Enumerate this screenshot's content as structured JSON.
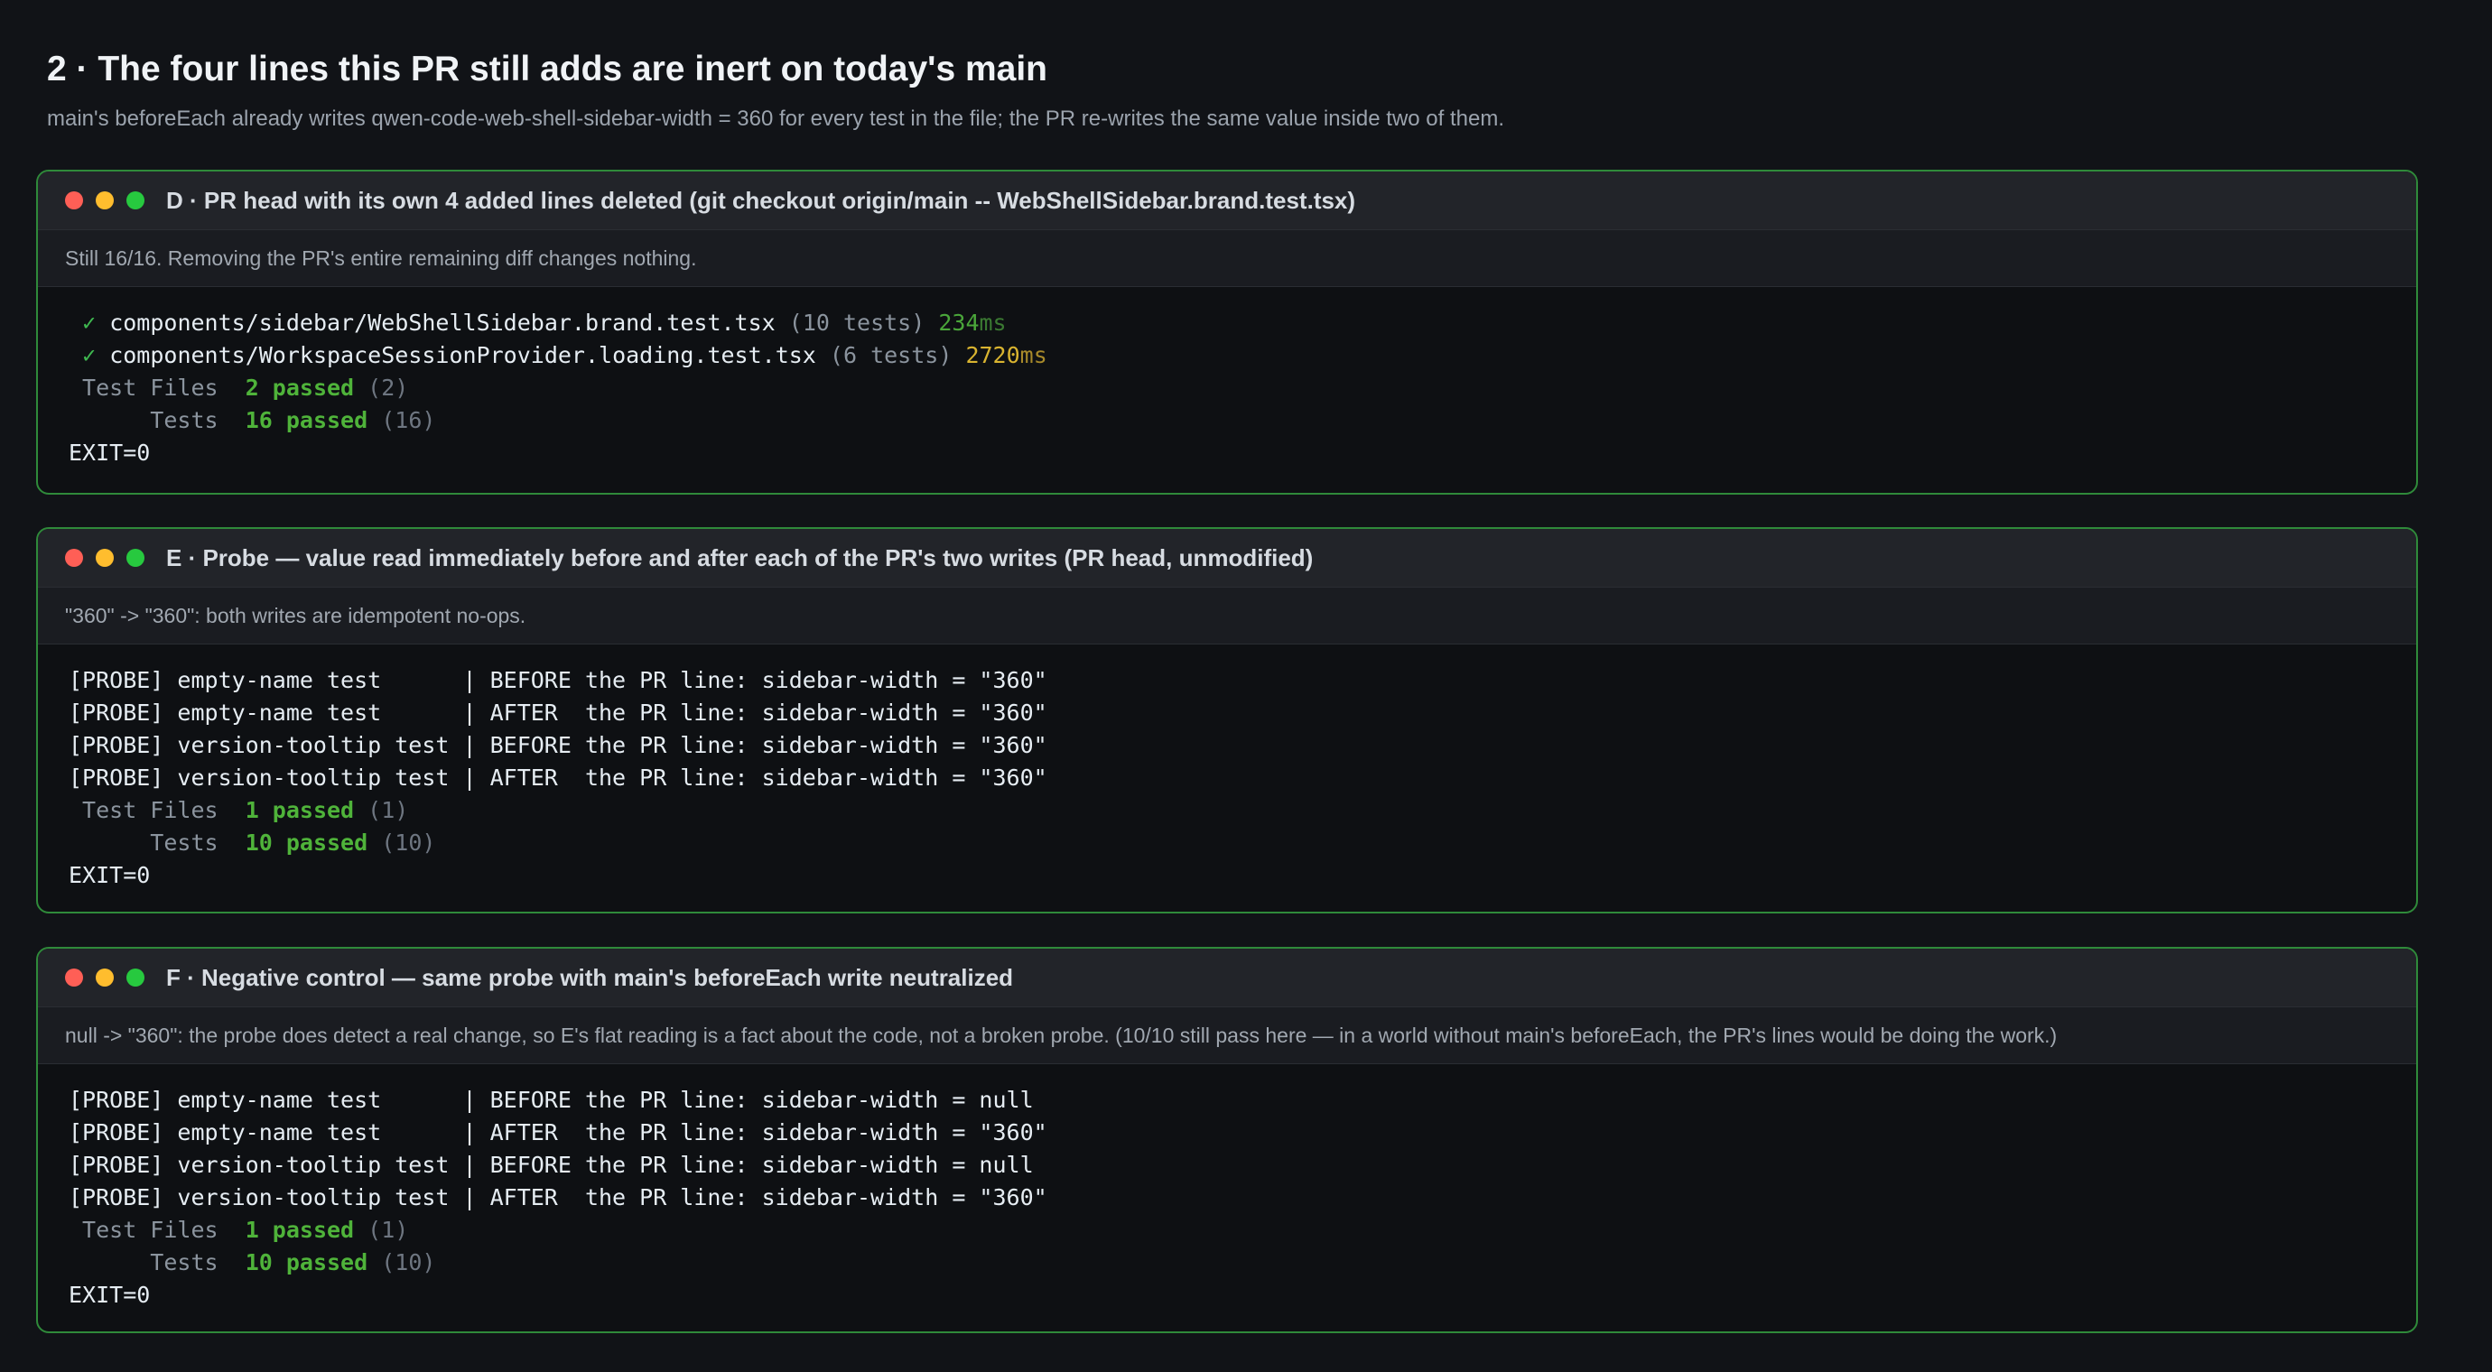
{
  "section": {
    "title": "2 · The four lines this PR still adds are inert on today's main",
    "subtitle": "main's beforeEach already writes qwen-code-web-shell-sidebar-width = 360 for every test in the file; the PR re-writes the same value inside two of them."
  },
  "colors": {
    "background": "#111317",
    "border_green": "#2f8a3a",
    "passed_green": "#4fb33a",
    "ms_yellow": "#d9b430",
    "dot_red": "#ff5f56",
    "dot_yellow": "#ffbd2e",
    "dot_green": "#27c93f"
  },
  "terminals": [
    {
      "title": "D · PR head with its own 4 added lines deleted (git checkout origin/main -- WebShellSidebar.brand.test.tsx)",
      "note": "Still 16/16. Removing the PR's entire remaining diff changes nothing.",
      "test_lines": [
        {
          "check": "✓",
          "file": "components/sidebar/WebShellSidebar.brand.test.tsx",
          "count": "(10 tests)",
          "ms": "234",
          "unit": "ms"
        },
        {
          "check": "✓",
          "file": "components/WorkspaceSessionProvider.loading.test.tsx",
          "count": "(6 tests)",
          "ms": "2720",
          "unit": "ms"
        }
      ],
      "summary": {
        "files_label": " Test Files",
        "files_passed": "2 passed",
        "files_total": "(2)",
        "tests_label": "      Tests",
        "tests_passed": "16 passed",
        "tests_total": "(16)",
        "exit": "EXIT=0"
      }
    },
    {
      "title": "E · Probe — value read immediately before and after each of the PR's two writes (PR head, unmodified)",
      "note": "\"360\" -> \"360\": both writes are idempotent no-ops.",
      "probe_lines": [
        "[PROBE] empty-name test      | BEFORE the PR line: sidebar-width = \"360\"",
        "[PROBE] empty-name test      | AFTER  the PR line: sidebar-width = \"360\"",
        "[PROBE] version-tooltip test | BEFORE the PR line: sidebar-width = \"360\"",
        "[PROBE] version-tooltip test | AFTER  the PR line: sidebar-width = \"360\""
      ],
      "summary": {
        "files_label": " Test Files",
        "files_passed": "1 passed",
        "files_total": "(1)",
        "tests_label": "      Tests",
        "tests_passed": "10 passed",
        "tests_total": "(10)",
        "exit": "EXIT=0"
      }
    },
    {
      "title": "F · Negative control — same probe with main's beforeEach write neutralized",
      "note": "null -> \"360\": the probe does detect a real change, so E's flat reading is a fact about the code, not a broken probe. (10/10 still pass here — in a world without main's beforeEach, the PR's lines would be doing the work.)",
      "probe_lines": [
        "[PROBE] empty-name test      | BEFORE the PR line: sidebar-width = null",
        "[PROBE] empty-name test      | AFTER  the PR line: sidebar-width = \"360\"",
        "[PROBE] version-tooltip test | BEFORE the PR line: sidebar-width = null",
        "[PROBE] version-tooltip test | AFTER  the PR line: sidebar-width = \"360\""
      ],
      "summary": {
        "files_label": " Test Files",
        "files_passed": "1 passed",
        "files_total": "(1)",
        "tests_label": "      Tests",
        "tests_passed": "10 passed",
        "tests_total": "(10)",
        "exit": "EXIT=0"
      }
    }
  ]
}
